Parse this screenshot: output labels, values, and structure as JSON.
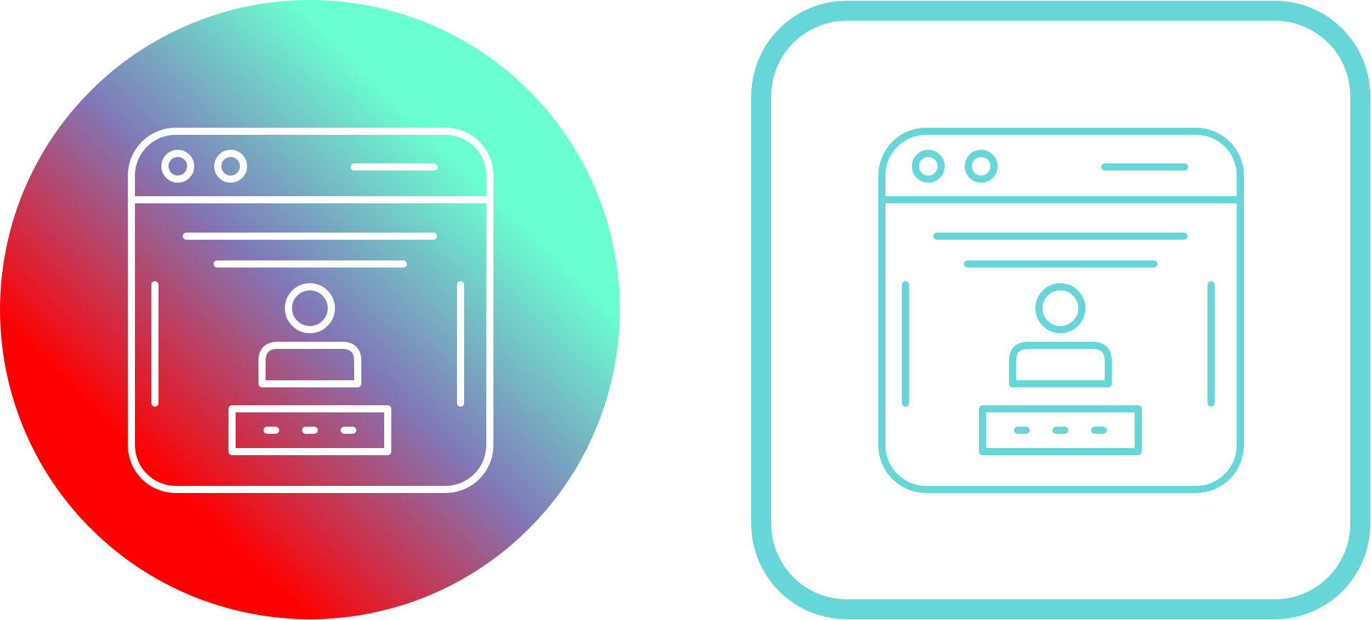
{
  "icons": [
    {
      "variant": "gradient-circle",
      "icon": "user-login-webpage-icon",
      "background": {
        "shape": "circle",
        "gradient": [
          "#ff0000",
          "#8078b8",
          "#6affd0"
        ]
      },
      "stroke_color": "#ffffff"
    },
    {
      "variant": "outline-rounded-square",
      "icon": "user-login-webpage-icon",
      "background": {
        "shape": "rounded-square",
        "fill": "#ffffff",
        "border_color": "#66d6d8"
      },
      "stroke_color": "#66d6d8"
    }
  ]
}
